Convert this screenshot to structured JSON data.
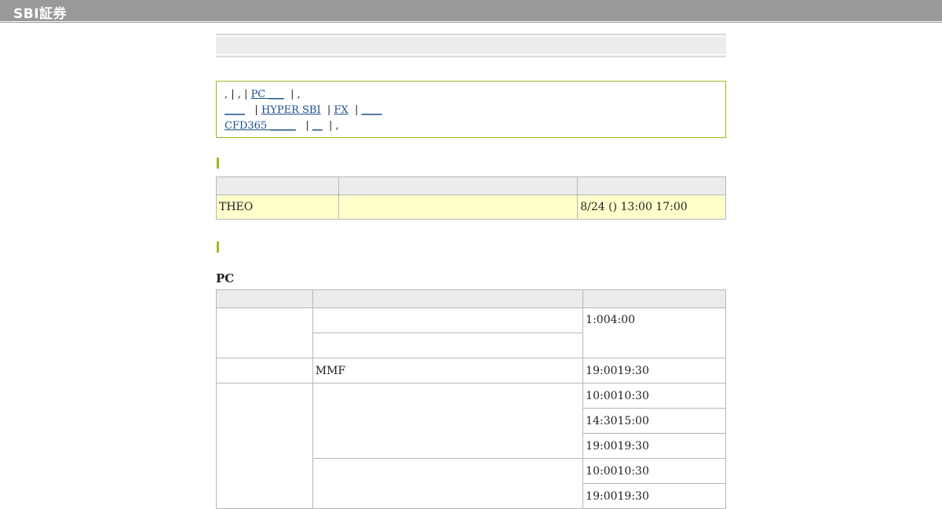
{
  "header": {
    "logo": "SBI証券"
  },
  "notice": {
    "row1": {
      "prefix": ", | , |",
      "link_pc": "PC ___",
      "suffix": "| ,"
    },
    "row2": {
      "link_a": "____",
      "sep1": "|",
      "link_hyper": "HYPER SBI",
      "sep2": "|",
      "link_fx": "FX",
      "sep3": "|",
      "link_b": "____"
    },
    "row3": {
      "link_cfd": "CFD365 _____",
      "sep1": "|",
      "link_c": "__",
      "suffix": "| ,"
    }
  },
  "table1": {
    "headers": [
      "",
      "",
      ""
    ],
    "row": {
      "name": "THEO",
      "detail": "",
      "schedule": "8/24 () 13:00  17:00"
    }
  },
  "section_pc": {
    "title": "PC"
  },
  "table2": {
    "headers": [
      "",
      "",
      ""
    ],
    "rows": {
      "r1_time": " 1:004:00",
      "r3_item": "MMF",
      "r3_time": "19:0019:30",
      "r4_time": "10:0010:30",
      "r5_time": "14:3015:00",
      "r6_time": "19:0019:30",
      "r7_time": "10:0010:30",
      "r8_time": "19:0019:30"
    }
  }
}
